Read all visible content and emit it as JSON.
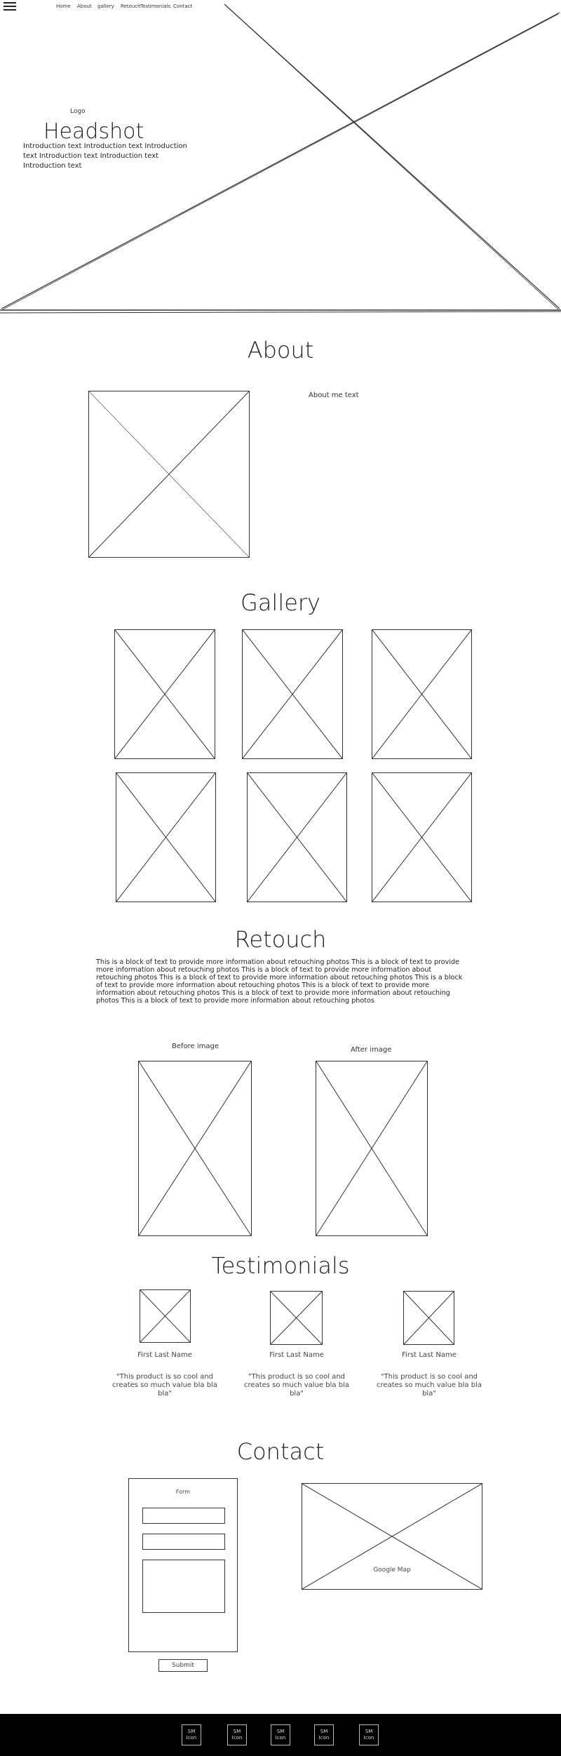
{
  "nav": {
    "items": [
      "Home",
      "About",
      "gallery",
      "Retouch",
      "Testimonials",
      "Contact"
    ]
  },
  "hero": {
    "logo": "Logo",
    "title": "Headshot",
    "intro": "Introduction text Introduction text Introduction text Introduction text Introduction text Introduction text"
  },
  "about": {
    "heading": "About",
    "text": "About me text"
  },
  "gallery": {
    "heading": "Gallery"
  },
  "retouch": {
    "heading": "Retouch",
    "text": "This is a block of text to provide more information about retouching photos This is a block of text to provide more information about retouching photos This is a block of text to provide more information about retouching photos This is a block of text to provide more information about retouching photos This is a block of text to provide more information about retouching photos This is a block of text to provide more information about retouching photos This is a block of text to provide more information about retouching photos This is a block of text to provide more information about retouching photos",
    "before_label": "Before image",
    "after_label": "After image"
  },
  "testimonials": {
    "heading": "Testimonials",
    "items": [
      {
        "name": "First Last Name",
        "quote": "\"This product is so cool and creates so much value bla bla bla\""
      },
      {
        "name": "First Last Name",
        "quote": "\"This product is so cool and creates so much value bla bla bla\""
      },
      {
        "name": "First Last Name",
        "quote": "\"This product is so cool and creates so much value bla bla bla\""
      }
    ]
  },
  "contact": {
    "heading": "Contact",
    "form_label": "Form",
    "submit_label": "Submit",
    "map_label": "Google Map"
  },
  "footer": {
    "social": [
      "SM Icon",
      "SM Icon",
      "SM Icon",
      "SM Icon",
      "SM Icon"
    ]
  }
}
